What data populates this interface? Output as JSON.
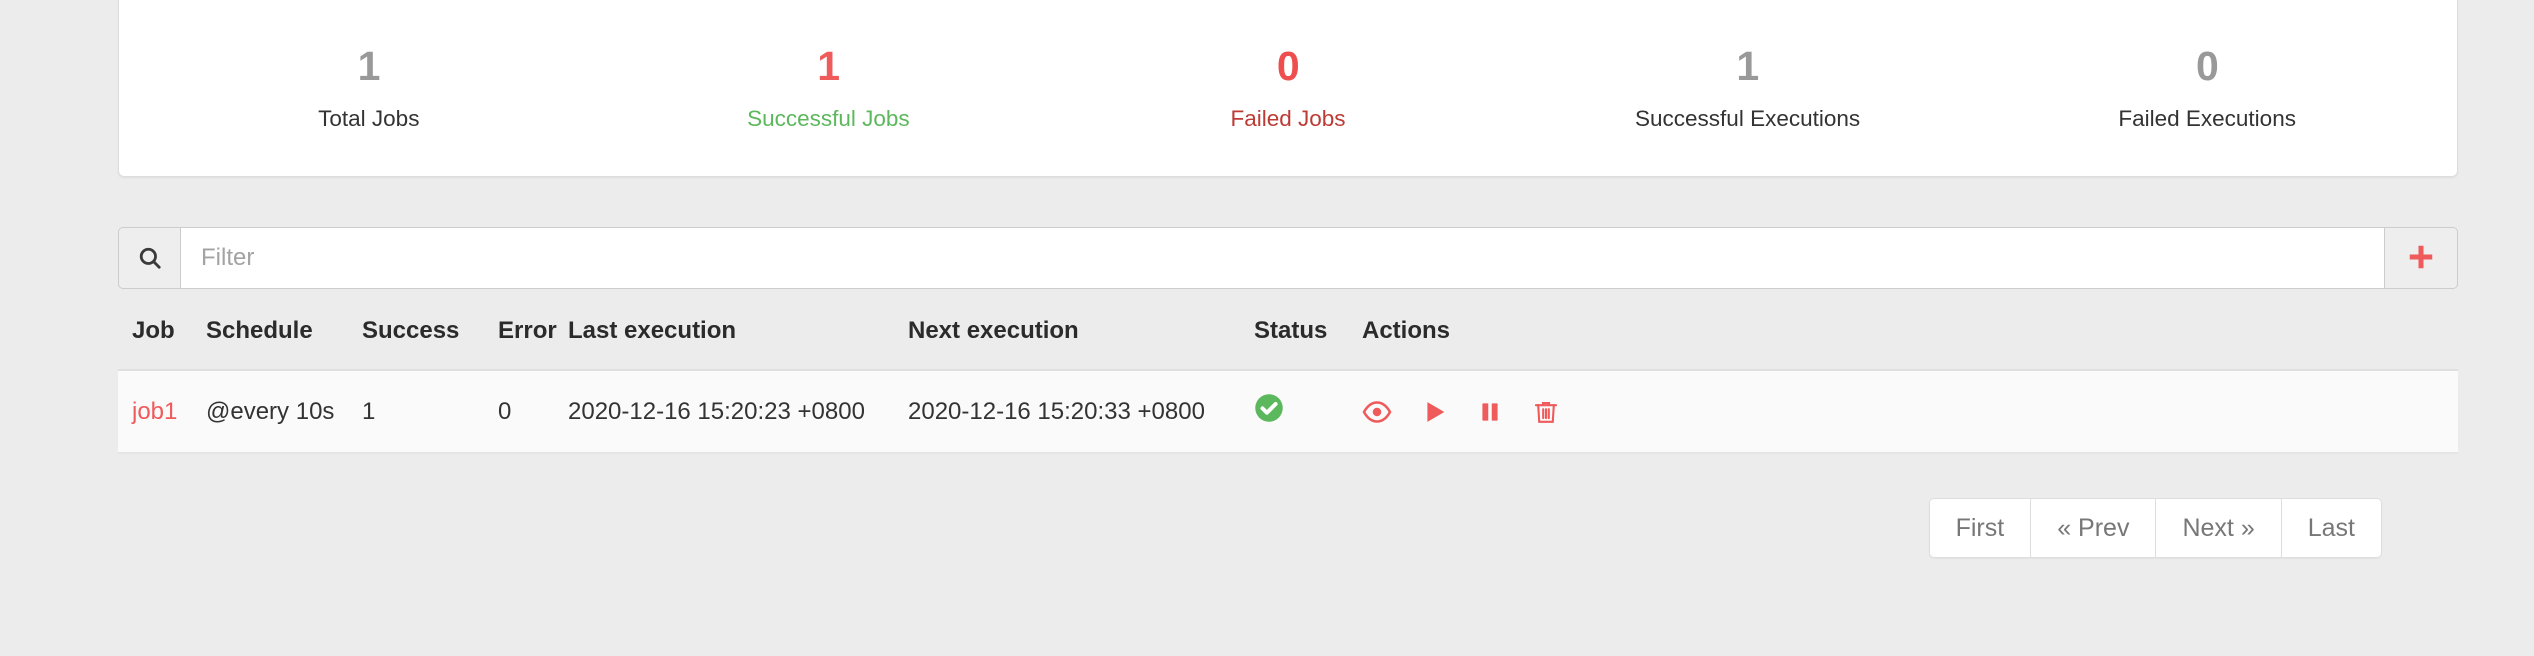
{
  "stats": [
    {
      "value": "1",
      "label": "Total Jobs",
      "tone": "neutral"
    },
    {
      "value": "1",
      "label": "Successful Jobs",
      "tone": "success"
    },
    {
      "value": "0",
      "label": "Failed Jobs",
      "tone": "failed"
    },
    {
      "value": "1",
      "label": "Successful Executions",
      "tone": "neutral"
    },
    {
      "value": "0",
      "label": "Failed Executions",
      "tone": "neutral"
    }
  ],
  "filter": {
    "search_icon": "search-icon",
    "placeholder": "Filter",
    "value": "",
    "add_icon": "plus-icon",
    "add_label": "+"
  },
  "table": {
    "headers": {
      "job": "Job",
      "schedule": "Schedule",
      "success": "Success",
      "error": "Error",
      "last_execution": "Last execution",
      "next_execution": "Next execution",
      "status": "Status",
      "actions": "Actions"
    },
    "rows": [
      {
        "job": "job1",
        "schedule": "@every 10s",
        "success": "1",
        "error": "0",
        "last_execution": "2020-12-16 15:20:23 +0800",
        "next_execution": "2020-12-16 15:20:33 +0800",
        "status": "success",
        "status_icon": "check-circle-icon",
        "actions": [
          {
            "name": "view-icon",
            "title": "View"
          },
          {
            "name": "play-icon",
            "title": "Run"
          },
          {
            "name": "pause-icon",
            "title": "Pause"
          },
          {
            "name": "trash-icon",
            "title": "Delete"
          }
        ]
      }
    ]
  },
  "pagination": {
    "first": "First",
    "prev": "« Prev",
    "next": "Next »",
    "last": "Last"
  },
  "colors": {
    "page_background": "#ececec",
    "card_background": "#ffffff",
    "accent_red": "#ef5a5a",
    "success_green": "#5cb85c",
    "failed_red": "#bc3b35",
    "neutral_gray": "#999999",
    "row_background": "#fafafa",
    "border": "#dddddd"
  }
}
